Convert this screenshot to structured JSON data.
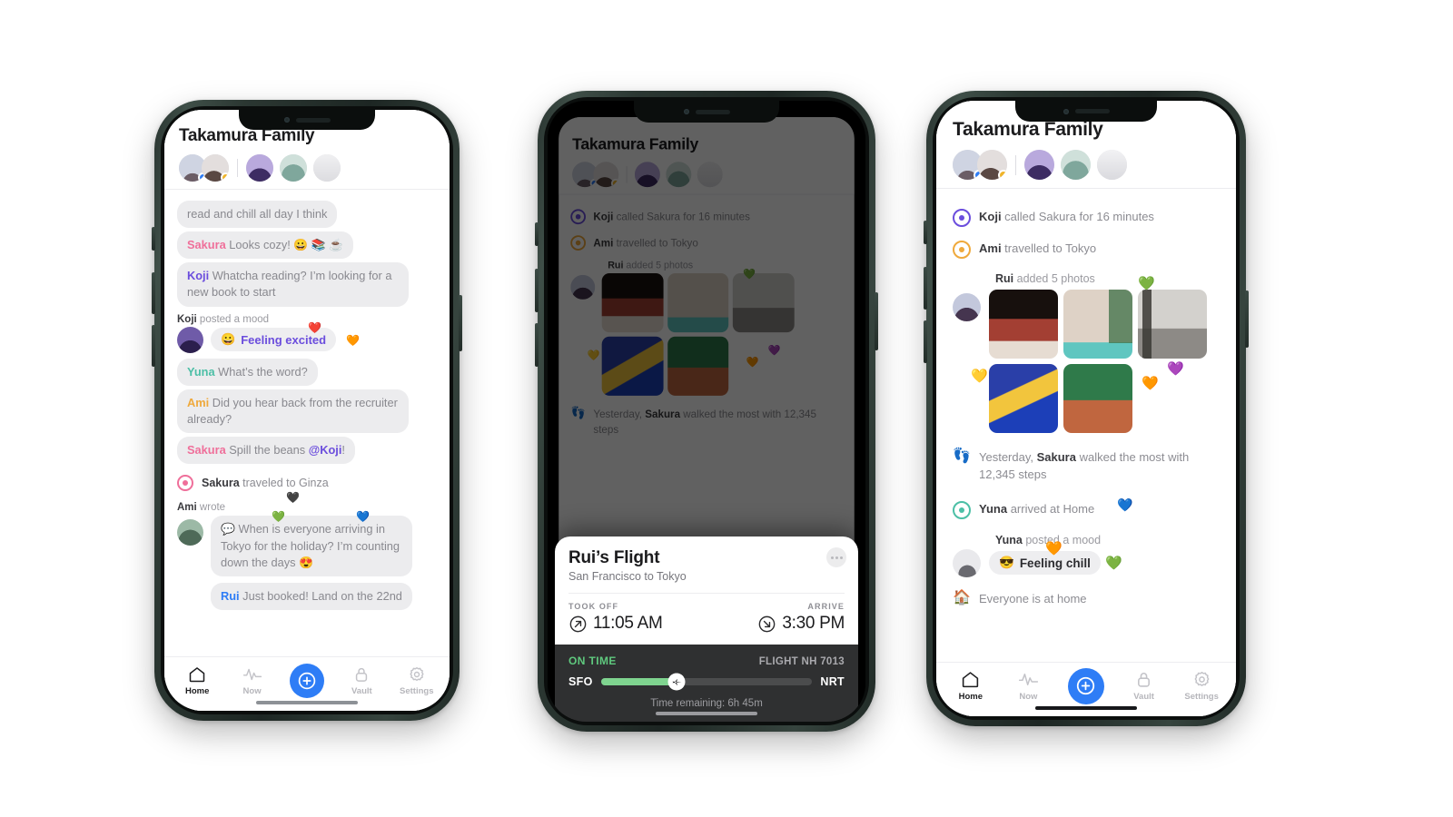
{
  "colors": {
    "koji": "#6b4ddd",
    "sakura": "#ef6f9a",
    "yuna": "#4cbfa6",
    "ami": "#efa93c",
    "rui": "#2e7df6",
    "accent": "#2e7df6",
    "ontime": "#5fc97e",
    "progress": "#7fd48f"
  },
  "app": {
    "title": "Takamura Family",
    "avatars": [
      {
        "name": "avatar-sakura",
        "badge": "#2e7df6",
        "c1": "#c9cfe0",
        "c2": "#8e7f92"
      },
      {
        "name": "avatar-ami",
        "badge": "#f0b429",
        "c1": "#dcd8d8",
        "c2": "#6d5c5a"
      },
      {
        "name": "avatar-koji",
        "badge": "",
        "c1": "#b9a9dd",
        "c2": "#5b4a8c"
      },
      {
        "name": "avatar-yuna",
        "badge": "",
        "c1": "#bcd6cf",
        "c2": "#7fa79c"
      },
      {
        "name": "avatar-rui",
        "badge": "",
        "c1": "#e7e7e9",
        "c2": "#c4c6ca"
      }
    ]
  },
  "tabbar": {
    "items": [
      {
        "label": "Home",
        "icon": "home-icon",
        "active": true
      },
      {
        "label": "Now",
        "icon": "pulse-icon",
        "active": false
      },
      {
        "label": "",
        "icon": "plus-circle-icon",
        "active": false
      },
      {
        "label": "Vault",
        "icon": "lock-icon",
        "active": false
      },
      {
        "label": "Settings",
        "icon": "gear-icon",
        "active": false
      }
    ]
  },
  "chat": {
    "messages": [
      {
        "type": "bubble",
        "name": "",
        "text": "read and chill all day I think"
      },
      {
        "type": "bubble",
        "name": "Sakura",
        "color": "sakura",
        "text": " Looks cozy! 😀 📚 ☕"
      },
      {
        "type": "bubble",
        "name": "Koji",
        "color": "koji",
        "text": " Whatcha reading? I’m looking for a new book to start"
      }
    ],
    "mood_label_name": "Koji",
    "mood_label_rest": " posted a mood",
    "mood_text": "Feeling excited",
    "mood_emoji": "😀",
    "mood_hearts": [
      "❤️",
      "🧡"
    ],
    "after_mood": [
      {
        "type": "bubble",
        "name": "Yuna",
        "color": "yuna",
        "text": " What’s the word?"
      },
      {
        "type": "bubble",
        "name": "Ami",
        "color": "ami",
        "text": " Did you hear back from the recruiter already?"
      },
      {
        "type": "bubble",
        "name": "Sakura",
        "color": "sakura",
        "text": " Spill the beans ",
        "mention": "@Koji",
        "tail": "!"
      }
    ],
    "travel_name": "Sakura",
    "travel_rest": " traveled to Ginza",
    "wrote_name": "Ami",
    "wrote_rest": " wrote",
    "wrote_hearts": [
      "🖤",
      "💚",
      "💙"
    ],
    "wrote_text": "When is everyone arriving in Tokyo for the holiday? I’m counting down the days 😍",
    "wrote_icon": "💬",
    "last_name": "Rui",
    "last_color": "rui",
    "last_text": " Just booked! Land on the 22nd"
  },
  "feed": {
    "items": [
      {
        "kind": "status",
        "icon": "target-icon",
        "color": "#6b4ddd",
        "name": "Koji",
        "rest": " called Sakura for 16 minutes"
      },
      {
        "kind": "status",
        "icon": "target-icon",
        "color": "#efa93c",
        "name": "Ami",
        "rest": " travelled to Tokyo"
      }
    ],
    "photos_label_name": "Rui",
    "photos_label_rest": " added 5 photos",
    "photos": [
      {
        "name": "photo-riad-lounge",
        "c1": "#1c1410",
        "c2": "#a33f33",
        "c3": "#e8ded5"
      },
      {
        "name": "photo-courtyard-pool",
        "c1": "#ded2c6",
        "c2": "#5fc6c0",
        "c3": "#3c6f46"
      },
      {
        "name": "photo-hallway",
        "c1": "#cfcdc9",
        "c2": "#8d8a86",
        "c3": "#3a3834"
      },
      {
        "name": "photo-blue-building",
        "c1": "#1c3fb8",
        "c2": "#f2c53d",
        "c3": "#2a2f7a"
      },
      {
        "name": "photo-palm-garden",
        "c1": "#c0663f",
        "c2": "#2f7a4a",
        "c3": "#d98d5e"
      }
    ],
    "photo_hearts": [
      "💚",
      "💜",
      "🧡",
      "💛"
    ],
    "steps_icon": "footprints-icon",
    "steps_pre": "Yesterday, ",
    "steps_name": "Sakura",
    "steps_rest": " walked the most with 12,345 steps",
    "arrived": {
      "icon": "target-icon",
      "color": "#4cbfa6",
      "name": "Yuna",
      "rest": " arrived at Home",
      "heart": "💙"
    },
    "mood_label_name": "Yuna",
    "mood_label_rest": " posted a mood",
    "mood_text": "Feeling chill",
    "mood_emoji": "😎",
    "mood_hearts": [
      "🧡",
      "💚"
    ],
    "home_icon": "house-icon",
    "home_text": "Everyone is at home"
  },
  "flight": {
    "title": "Rui’s Flight",
    "subtitle": "San Francisco to Tokyo",
    "more_icon": "more-dots-icon",
    "depart_caption": "TOOK OFF",
    "depart_time": "11:05 AM",
    "depart_icon": "arrow-up-right-icon",
    "arrive_caption": "ARRIVE",
    "arrive_time": "3:30 PM",
    "arrive_icon": "arrow-down-right-icon",
    "status": "ON TIME",
    "flight_number": "FLIGHT NH 7013",
    "origin": "SFO",
    "destination": "NRT",
    "progress_percent": 36,
    "plane_icon": "airplane-icon",
    "remaining": "Time remaining: 6h 45m"
  }
}
